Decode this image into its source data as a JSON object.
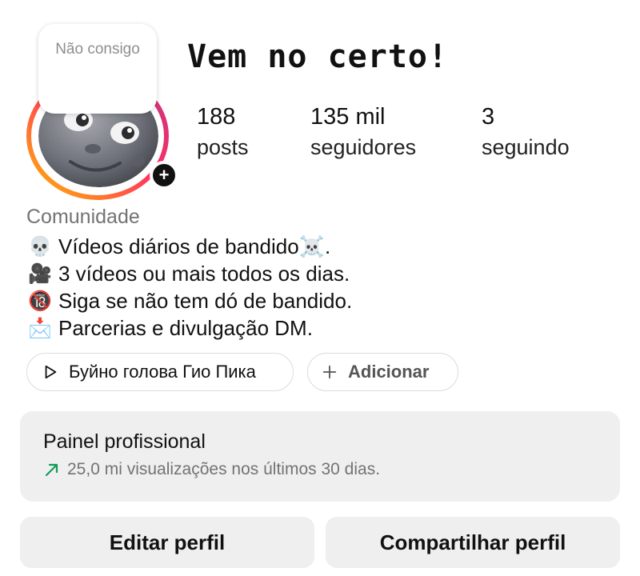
{
  "profile": {
    "note": "Não consigo",
    "display_name": "Vem no certo!",
    "avatar_icon": "moon-face-icon",
    "add_story_icon": "plus-icon"
  },
  "stats": {
    "posts": {
      "value": "188",
      "label": "posts"
    },
    "followers": {
      "value": "135 mil",
      "label": "seguidores"
    },
    "following": {
      "value": "3",
      "label": "seguindo"
    }
  },
  "category": "Comunidade",
  "bio": [
    {
      "icon": "skull-icon",
      "glyph": "💀",
      "text": "Vídeos diários de bandido☠️."
    },
    {
      "icon": "video-camera-icon",
      "glyph": "🎥",
      "text": "3 vídeos ou mais todos os dias."
    },
    {
      "icon": "no-under-18-icon",
      "glyph": "🔞",
      "text": "Siga se não tem dó de bandido."
    },
    {
      "icon": "envelope-arrow-icon",
      "glyph": "📩",
      "text": "Parcerias e divulgação DM."
    }
  ],
  "chips": {
    "audio": {
      "label": "Буйно голова Гио Пика",
      "icon": "play-icon"
    },
    "add": {
      "label": "Adicionar",
      "icon": "plus-icon"
    }
  },
  "dashboard": {
    "title": "Painel profissional",
    "subtitle": "25,0 mi visualizações nos últimos 30 dias.",
    "icon": "trend-up-icon",
    "accent": "#0f9d58"
  },
  "buttons": {
    "edit": "Editar perfil",
    "share": "Compartilhar perfil"
  },
  "colors": {
    "ring_start": "#ffb800",
    "ring_mid": "#ff2e63",
    "ring_end": "#c13584",
    "muted_text": "#737373",
    "button_bg": "#efefef"
  }
}
